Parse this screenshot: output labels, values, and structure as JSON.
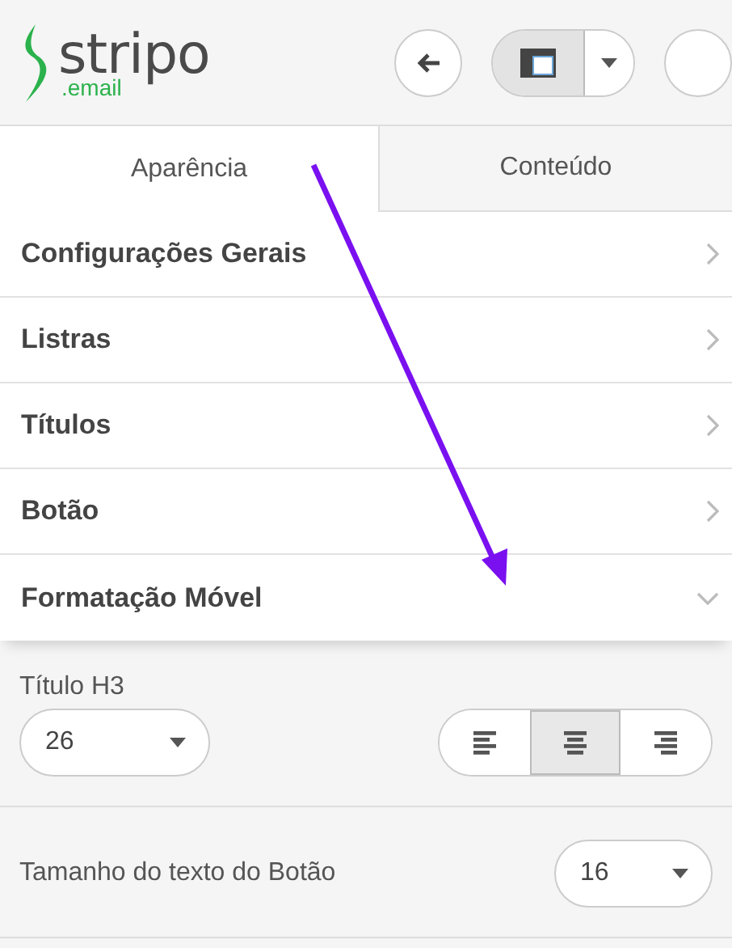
{
  "logo": {
    "name": "stripo",
    "suffix": ".email"
  },
  "toolbar": [
    {
      "kind": "back",
      "pressed": false
    },
    {
      "kind": "layout",
      "pressed": true
    },
    {
      "kind": "dropdown",
      "pressed": false
    },
    {
      "kind": "round",
      "pressed": false
    }
  ],
  "tabs": [
    {
      "label": "Aparência",
      "selected": true
    },
    {
      "label": "Conteúdo",
      "selected": false
    }
  ],
  "sections": [
    {
      "label": "Configurações Gerais",
      "expanded": false
    },
    {
      "label": "Listras",
      "expanded": false
    },
    {
      "label": "Títulos",
      "expanded": false
    },
    {
      "label": "Botão",
      "expanded": false
    },
    {
      "label": "Formatação Móvel",
      "expanded": true
    }
  ],
  "mobile": {
    "heading_label": "Título H3",
    "heading_size": "26",
    "alignment": [
      {
        "kind": "left",
        "selected": false
      },
      {
        "kind": "center",
        "selected": true
      },
      {
        "kind": "right",
        "selected": false
      }
    ],
    "button_text_label": "Tamanho do texto do Botão",
    "button_text_size": "16"
  }
}
